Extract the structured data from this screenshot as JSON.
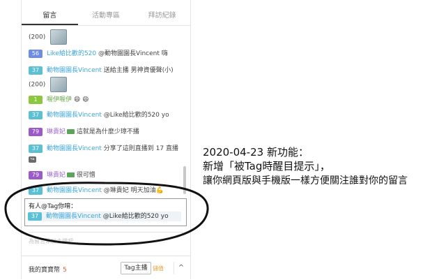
{
  "tabs": [
    "留言",
    "活動專區",
    "拜訪紀錄"
  ],
  "messages": [
    {
      "pre": "(200)"
    },
    {
      "level": "56",
      "user": "Like給比歡的520",
      "text": "@動物園園長Vincent 嗨"
    },
    {
      "level": "37",
      "user": "動物園園長Vincent",
      "text": "送給主播 男神資優聲(小)"
    },
    {
      "pre": "(200)"
    },
    {
      "level": "1",
      "user": "喔伊喔伊",
      "text": "😄 😄"
    },
    {
      "level": "37",
      "user": "動物園園長Vincent",
      "text": "@Like給比歡的520 yo"
    },
    {
      "level": "79",
      "user": "琳貴妃",
      "text": "這就是為什麼少璋不播"
    },
    {
      "level": "37",
      "user": "動物園園長Vincent",
      "text": "分享了這則直播到 17 直播"
    },
    {
      "level": "79",
      "user": "琳貴妃",
      "text": "很可憎"
    },
    {
      "level": "37",
      "user": "動物園園長Vincent",
      "text": "@琳貴妃 明天加油💪"
    }
  ],
  "tag_box": {
    "title": "有人@Tag你唷：",
    "level": "37",
    "user": "動物園園長Vincent",
    "text": "@Like給比歡的520 yo"
  },
  "input_placeholder": "為留言添加主播吧...",
  "footer": {
    "label": "我的寶寶幣",
    "count": "5",
    "tag_button": "Tag主播",
    "value": "儲值",
    "chevron": "^"
  },
  "note_lines": [
    "2020-04-23 新功能：",
    "新增「被Tag時醒目提示」，",
    "讓你網頁版與手機版一樣方便關注誰對你的留言"
  ],
  "colors": {
    "level_teal": "#5cc0d4",
    "level_blue": "#6e8ce6",
    "level_purple": "#9b59c9",
    "level_green": "#8dc63f",
    "username": "#3aa6d8"
  },
  "icons": [
    "gift-thumbnail-icon",
    "money-icon",
    "repost-icon",
    "chevron-up-icon"
  ]
}
